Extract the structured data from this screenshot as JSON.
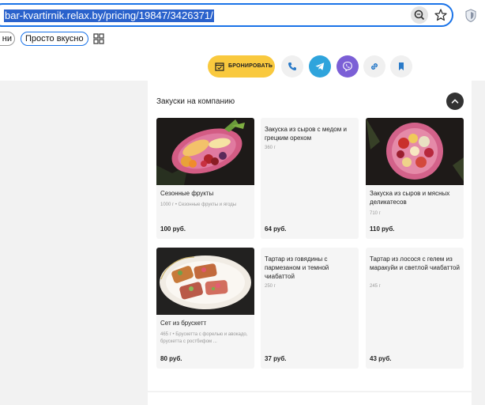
{
  "browser": {
    "url": "bar-kvartirnik.relax.by/pricing/19847/3426371/",
    "bookmarks": [
      {
        "label": "ни"
      },
      {
        "label": "Просто вкусно"
      }
    ]
  },
  "toolbar": {
    "book_label": "БРОНИРОВАТЬ",
    "colors": {
      "book": "#f9c93e",
      "telegram": "#2fa4dc",
      "viber": "#7b5fd6"
    }
  },
  "section": {
    "title": "Закуски на компанию",
    "items": [
      {
        "name": "Сезонные фрукты",
        "details": "1000 г • Сезонные фрукты и ягоды",
        "price": "100 руб."
      },
      {
        "name": "Закуска из сыров с медом и грецким орехом",
        "details": "360 г",
        "price": "64 руб."
      },
      {
        "name": "Закуска из сыров и мясных деликатесов",
        "details": "710 г",
        "price": "110 руб."
      },
      {
        "name": "Сет из брускетт",
        "details": "465 г • Брускетта с форелью и авокадо, брускетта с ростбифом ...",
        "price": "80 руб."
      },
      {
        "name": "Тартар из говядины с пармезаном и темной чиабаттой",
        "details": "250 г",
        "price": "37 руб."
      },
      {
        "name": "Тартар из лосося с гелем из маракуйи и светлой чиабаттой",
        "details": "245 г",
        "price": "43 руб."
      }
    ]
  }
}
